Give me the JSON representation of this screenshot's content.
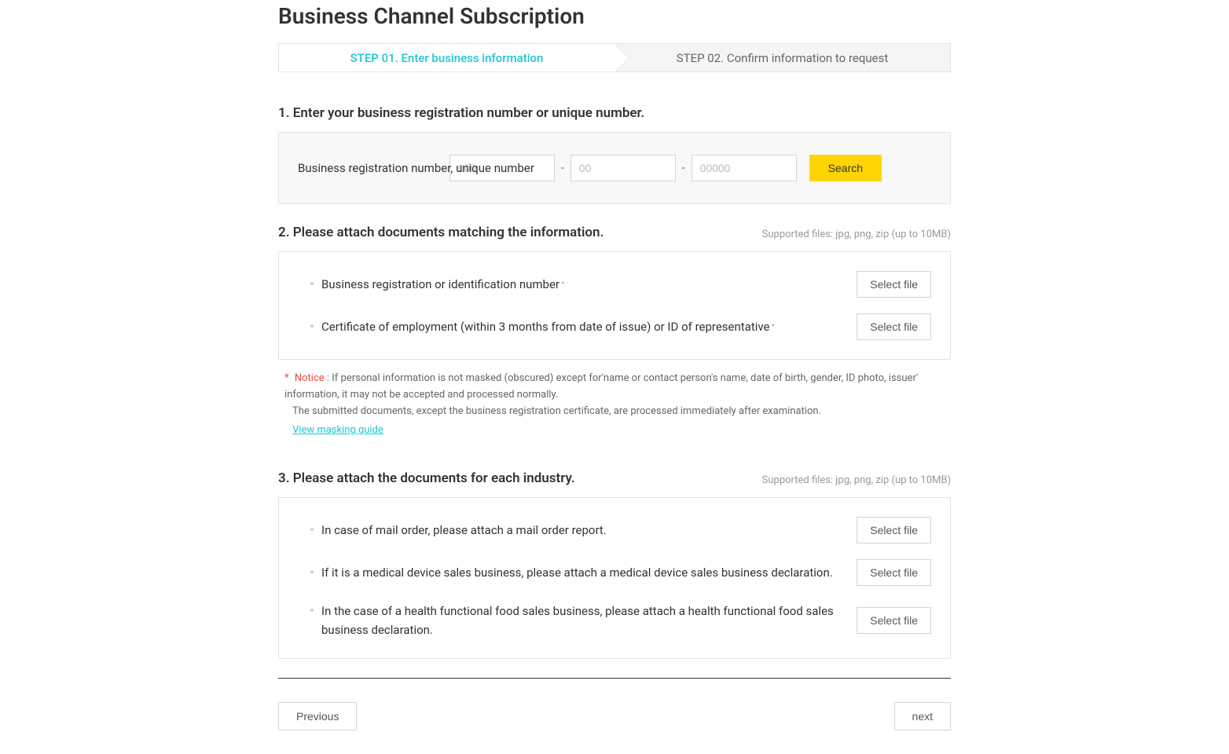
{
  "page": {
    "title": "Business Channel Subscription"
  },
  "steps": {
    "step1": "STEP 01. Enter business information",
    "step2": "STEP 02. Confirm information to request"
  },
  "section1": {
    "title": "1. Enter your business registration number or unique number.",
    "label": "Business registration number, unique number",
    "placeholder1": "000",
    "placeholder2": "00",
    "placeholder3": "00000",
    "search": "Search"
  },
  "section2": {
    "title": "2. Please attach documents matching the information.",
    "hint": "Supported files: jpg, png, zip (up to 10MB)",
    "doc1": "Business registration or identification number",
    "doc2": "Certificate of employment (within 3 months from date of issue) or ID of representative",
    "select_file": "Select file"
  },
  "notice": {
    "star": "*",
    "label": "Notice",
    "text1": " : If personal information is not masked (obscured) except for'name or contact person's name, date of birth, gender, ID photo, issuer' information, it may not be accepted and processed normally.",
    "text2": "The submitted documents, except the business registration certificate, are processed immediately after examination.",
    "link": "View masking guide"
  },
  "section3": {
    "title": "3. Please attach the documents for each industry.",
    "hint": "Supported files: jpg, png, zip (up to 10MB)",
    "doc1": "In case of mail order, please attach a mail order report.",
    "doc2": "If it is a medical device sales business, please attach a medical device sales business declaration.",
    "doc3": "In the case of a health functional food sales business, please attach a health functional food sales business declaration.",
    "select_file": "Select file"
  },
  "nav": {
    "prev": "Previous",
    "next": "next"
  }
}
